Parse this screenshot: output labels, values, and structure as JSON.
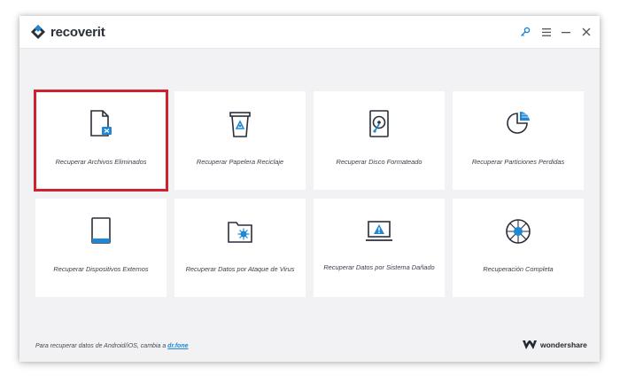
{
  "app": {
    "name": "recoverit"
  },
  "titlebar": {
    "icons": [
      "key-icon",
      "menu-icon",
      "minimize-icon",
      "close-icon"
    ]
  },
  "cards": [
    {
      "label": "Recuperar Archivos Eliminados",
      "icon": "deleted-file-icon",
      "highlighted": true
    },
    {
      "label": "Recuperar Papelera Reciclaje",
      "icon": "recycle-bin-icon"
    },
    {
      "label": "Recuperar Disco Formateado",
      "icon": "hard-disk-icon"
    },
    {
      "label": "Recuperar Particiones Perdidas",
      "icon": "partition-pie-icon"
    },
    {
      "label": "Recuperar Dispositivos Externos",
      "icon": "external-device-icon"
    },
    {
      "label": "Recuperar Datos por Ataque de Virus",
      "icon": "virus-folder-icon"
    },
    {
      "label": "Recuperar Datos por Sistema Dañado",
      "icon": "crashed-laptop-icon"
    },
    {
      "label": "Recuperación Completa",
      "icon": "complete-recovery-icon"
    }
  ],
  "footer": {
    "note_text": "Para recuperar datos de Android/iOS, cambia a",
    "link_text": "dr.fone",
    "brand": "wondershare"
  },
  "colors": {
    "accent": "#1e88d6",
    "highlight": "#d0222e",
    "background": "#f2f2f4"
  }
}
